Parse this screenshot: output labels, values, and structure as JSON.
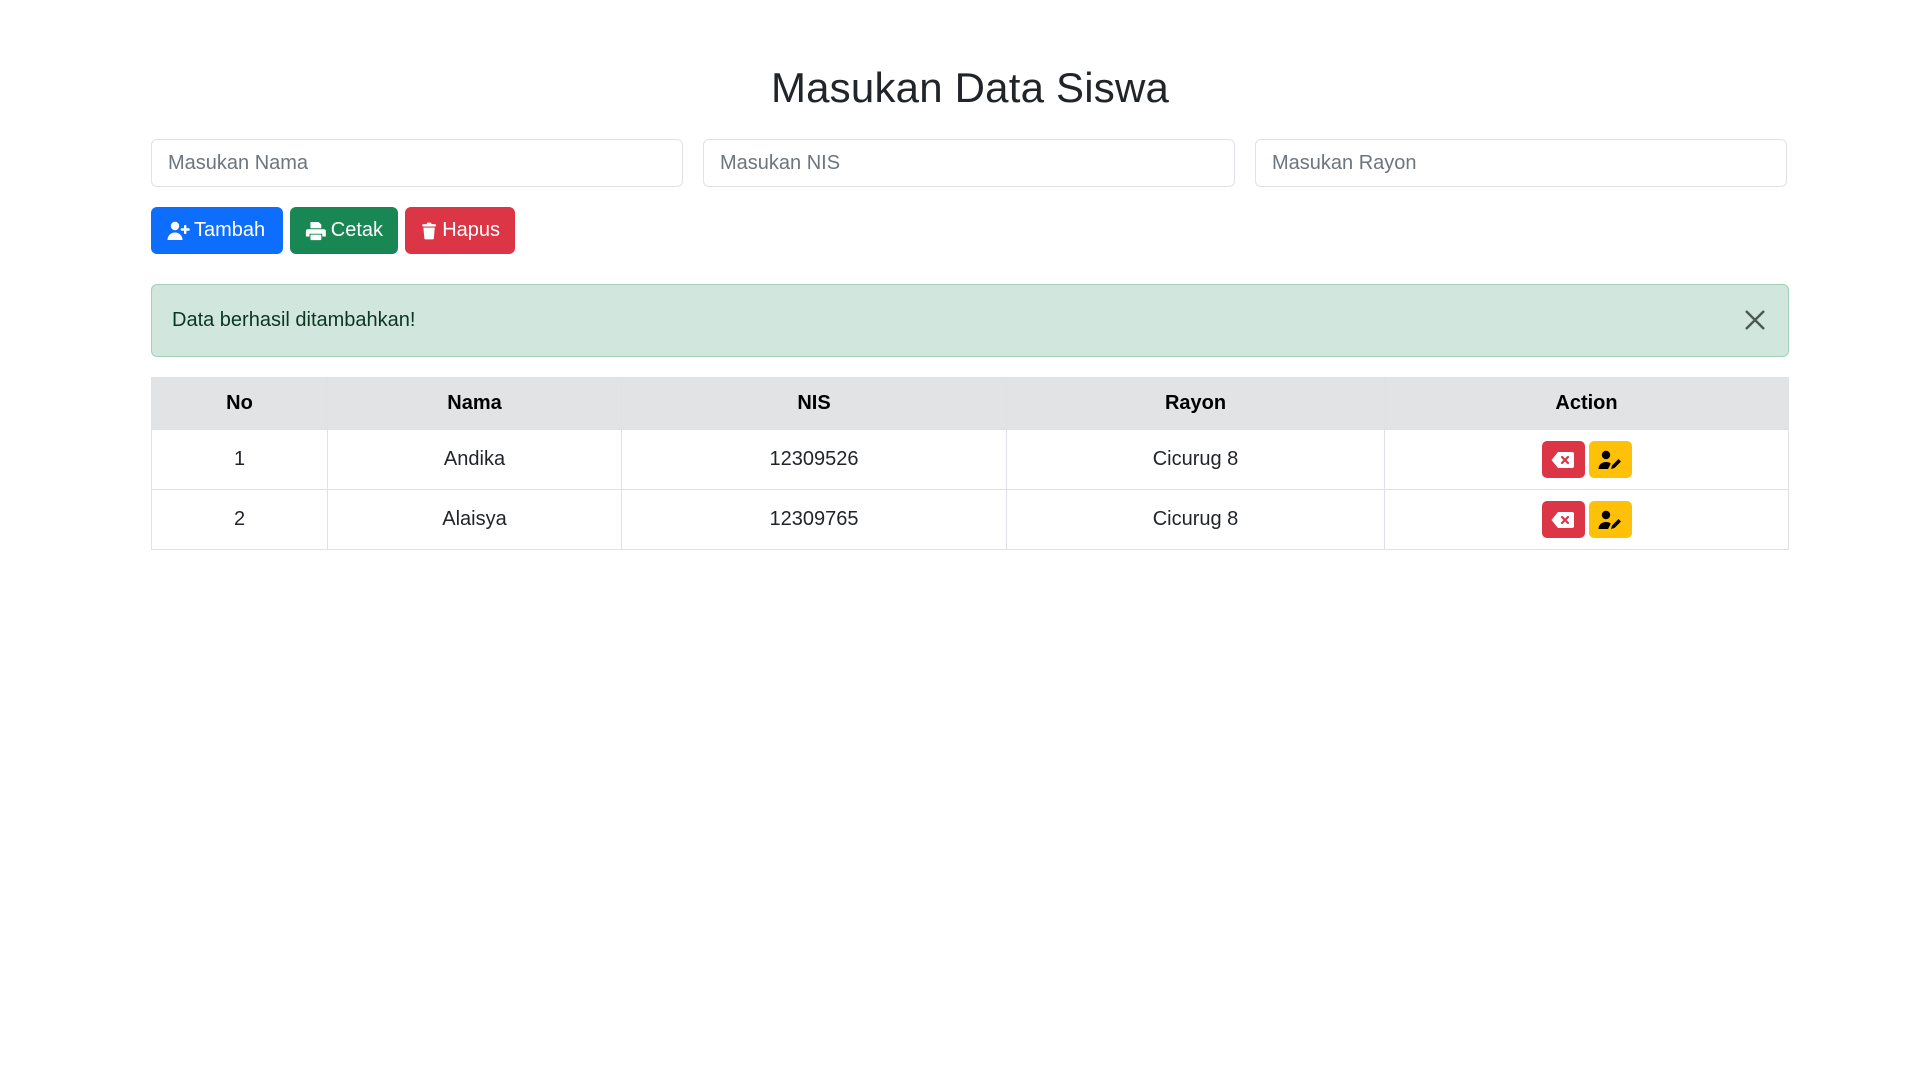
{
  "header": {
    "title": "Masukan Data Siswa"
  },
  "form": {
    "nama_placeholder": "Masukan Nama",
    "nis_placeholder": "Masukan NIS",
    "rayon_placeholder": "Masukan Rayon"
  },
  "toolbar": {
    "add_label": "Tambah",
    "print_label": "Cetak",
    "delete_label": "Hapus"
  },
  "alert": {
    "message": "Data berhasil ditambahkan!"
  },
  "table": {
    "headers": [
      "No",
      "Nama",
      "NIS",
      "Rayon",
      "Action"
    ],
    "rows": [
      {
        "no": "1",
        "nama": "Andika",
        "nis": "12309526",
        "rayon": "Cicurug 8"
      },
      {
        "no": "2",
        "nama": "Alaisya",
        "nis": "12309765",
        "rayon": "Cicurug 8"
      }
    ]
  },
  "colors": {
    "primary": "#0d6efd",
    "success": "#198754",
    "danger": "#dc3545",
    "warning": "#ffc107",
    "alert_bg": "#d1e7dd"
  }
}
